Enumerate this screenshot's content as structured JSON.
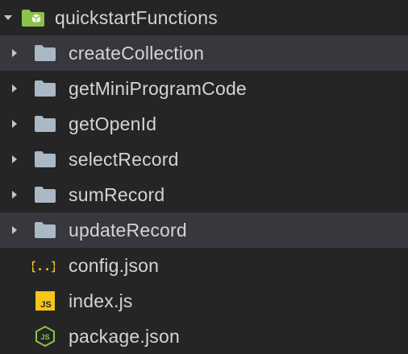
{
  "root": {
    "label": "quickstartFunctions",
    "folder_icon_color": "#8bc34a",
    "expanded": true
  },
  "items": [
    {
      "label": "createCollection",
      "type": "folder",
      "expanded": false,
      "selected": true
    },
    {
      "label": "getMiniProgramCode",
      "type": "folder",
      "expanded": false,
      "selected": false
    },
    {
      "label": "getOpenId",
      "type": "folder",
      "expanded": false,
      "selected": false
    },
    {
      "label": "selectRecord",
      "type": "folder",
      "expanded": false,
      "selected": false
    },
    {
      "label": "sumRecord",
      "type": "folder",
      "expanded": false,
      "selected": false
    },
    {
      "label": "updateRecord",
      "type": "folder",
      "expanded": false,
      "selected": true
    },
    {
      "label": "config.json",
      "type": "json-file",
      "icon": "json-braces-icon",
      "icon_glyph": "{..}",
      "icon_color": "#f5c518"
    },
    {
      "label": "index.js",
      "type": "js-file",
      "icon": "javascript-icon",
      "icon_glyph": "JS",
      "icon_color": "#f5c518"
    },
    {
      "label": "package.json",
      "type": "npm-file",
      "icon": "nodejs-icon",
      "icon_glyph": "JS",
      "icon_color": "#8bc34a"
    }
  ],
  "colors": {
    "background": "#252526",
    "selected_row": "#37373d",
    "text": "#d4d4d4",
    "folder": "#a9b8c4",
    "chevron": "#c5c5c5"
  }
}
